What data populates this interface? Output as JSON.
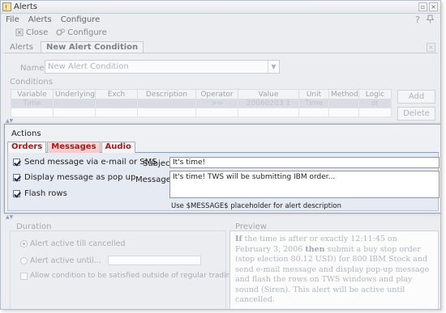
{
  "window": {
    "title": "Alerts",
    "help_icon": "?",
    "close_glyph": "×"
  },
  "menu": [
    "File",
    "Alerts",
    "Configure"
  ],
  "toolbar": {
    "close_label": "Close",
    "configure_label": "Configure"
  },
  "main_tabs": [
    {
      "label": "Alerts",
      "active": false
    },
    {
      "label": "New Alert Condition",
      "active": true
    }
  ],
  "name": {
    "label": "Name",
    "value": "New Alert Condition",
    "arrow": "▼"
  },
  "conditions": {
    "label": "Conditions",
    "columns": [
      "Variable",
      "Underlying",
      "Exch",
      "Description",
      "Operator",
      "Value",
      "Unit",
      "Method",
      "Logic"
    ],
    "rows": [
      [
        "Time",
        "",
        "",
        "",
        ">=",
        "20060203 1",
        "Time",
        "",
        "or"
      ],
      [
        "",
        "",
        "",
        "",
        "",
        "",
        "",
        "",
        ""
      ]
    ],
    "add_label": "Add",
    "delete_label": "Delete"
  },
  "actions": {
    "title": "Actions",
    "tabs": [
      {
        "label": "Orders",
        "active": false
      },
      {
        "label": "Messages",
        "active": true
      },
      {
        "label": "Audio",
        "active": false
      }
    ],
    "checks": [
      {
        "label": "Send message via e-mail or SMS",
        "checked": true
      },
      {
        "label": "Display message as pop up",
        "checked": true
      },
      {
        "label": "Flash rows",
        "checked": true
      }
    ],
    "subject_label": "Subject",
    "subject_value": "It's time!",
    "message_label": "Message",
    "message_value": "It's time! TWS will be submitting IBM order...",
    "hint": "Use $MESSAGE$ placeholder for alert description"
  },
  "duration": {
    "label": "Duration",
    "options": [
      {
        "label": "Alert active till cancelled",
        "selected": true
      },
      {
        "label": "Alert active until...",
        "selected": false
      }
    ],
    "outside_hours_label": "Allow condition to be satisfied outside of regular trading hours"
  },
  "preview": {
    "label": "Preview",
    "lead_bold": "If",
    "text_1": " the time is after or exactly 12:11:45 on February 3, 2006 ",
    "then_bold": "then",
    "text_2": " submit a buy stop order (stop election 80.12 USD) for 800 IBM Stock and send e-mail message and display pop-up message and flash the rows on TWS windows and play sound (Siren). This alert will be active until cancelled."
  }
}
